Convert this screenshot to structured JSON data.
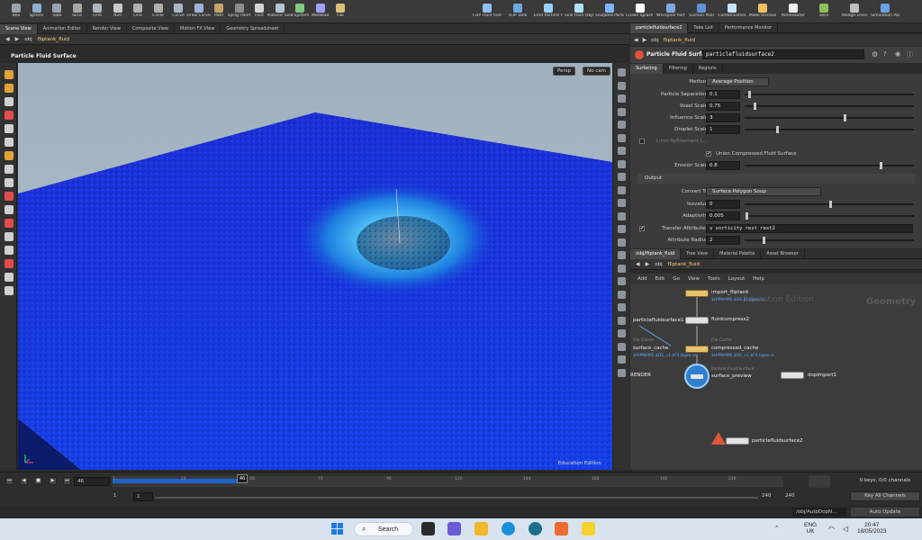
{
  "shelf": {
    "tools": [
      "Box",
      "Sphere",
      "Tube",
      "Torus",
      "Grid",
      "Null",
      "Line",
      "Circle",
      "Curve",
      "Draw Curve",
      "Path",
      "Spray Paint",
      "Font",
      "Platonic Solids",
      "L-System",
      "Metaball",
      "File"
    ],
    "right_tools": [
      "FLIP Fluid from Object",
      "FLIP Tank",
      "Emit Particle Fluid",
      "Sink from Objects",
      "Sculpted Particle Fluid",
      "Crown Splash Particle Fluid",
      "Whirlpool Particle Fluid",
      "Suction Pool",
      "Condensation",
      "Make Viscous",
      "Whitewater",
      "Slice",
      "Wedge Lines",
      "Simulation Particle Fluid"
    ]
  },
  "left_panel": {
    "tabs": [
      "Scene View",
      "Animation Editor",
      "Render View",
      "Composite View",
      "Motion FX View",
      "Geometry Spreadsheet"
    ],
    "path": [
      "obj",
      "fliptank_fluid"
    ],
    "viewport_title": "Particle Fluid Surface",
    "camera_menu": "Persp",
    "cam_menu": "No cam",
    "watermark": "Education Edition"
  },
  "param_panel": {
    "tabs": [
      "particlefluidsurface2",
      "Take List",
      "Performance Monitor"
    ],
    "node_type": "Particle Fluid Surface",
    "node_name": "particlefluidsurface2",
    "sub_tabs": [
      "Surfacing",
      "Filtering",
      "Regions"
    ],
    "params": {
      "method_label": "Method",
      "method_value": "Average Position",
      "psep_label": "Particle Separation",
      "psep_value": "0.1",
      "voxel_label": "Voxel Scale",
      "voxel_value": "0.75",
      "influence_label": "Influence Scale",
      "influence_value": "3",
      "droplet_label": "Droplet Scale",
      "droplet_value": "1",
      "limit_label": "Limit Refinement L...",
      "union_label": "Union Compressed Fluid Surface",
      "erosion_label": "Erosion Scale",
      "erosion_value": "0.8",
      "output_header": "Output",
      "convert_label": "Convert To",
      "convert_value": "Surface Polygon Soup",
      "iso_label": "Isovalue",
      "iso_value": "0",
      "adapt_label": "Adaptivity",
      "adapt_value": "0.005",
      "transfer_label": "Transfer Attributes",
      "transfer_value": "v vorticity rest rest2",
      "attrrad_label": "Attribute Radius",
      "attrrad_value": "2"
    }
  },
  "network_panel": {
    "tabs": [
      "/obj/fliptank_fluid",
      "Tree View",
      "Material Palette",
      "Asset Browser"
    ],
    "path": [
      "obj",
      "fliptank_fluid"
    ],
    "menu": [
      "Add",
      "Edit",
      "Go",
      "View",
      "Tools",
      "Layout",
      "Help"
    ],
    "watermark_edition": "Education Edition",
    "watermark_context": "Geometry",
    "nodes": {
      "import": {
        "name": "import_fliptank",
        "sub": "$HIPNAME.$OS.$F.bgeo.sc"
      },
      "compress": {
        "name": "fluidcompress2"
      },
      "pfs1": {
        "name": "particlefluidsurface1"
      },
      "cache": {
        "cap": "File Cache",
        "name": "compressed_cache",
        "sub": "$HIPNAME.$OS_v1.$F4.bgeo.sc"
      },
      "surfcache": {
        "cap": "File Cache",
        "name": "surface_cache",
        "sub": "$HIPNAME.$OS_v1.$F4.bgeo.sc"
      },
      "preview": {
        "cap": "Particle Fluid Surface",
        "name": "surface_preview"
      },
      "render": {
        "name": "RENDER"
      },
      "dop": {
        "name": "dopimport1"
      },
      "pfs2": {
        "name": "particlefluidsurface2"
      }
    }
  },
  "timeline": {
    "current_frame": "46",
    "start": "1",
    "start2": "1",
    "end": "240",
    "end2": "240",
    "ticks": [
      "1",
      "24",
      "48",
      "72",
      "96",
      "120",
      "144",
      "168",
      "192",
      "216"
    ],
    "keys_label": "0 keys, 0/0 channels",
    "channels_button": "Key All Channels",
    "auto_update": "Auto Update",
    "path_label": "/obj/AutoDopN..."
  },
  "taskbar": {
    "search": "Search",
    "lang": "ENG",
    "region": "UK",
    "time": "20:47",
    "date": "18/05/2023"
  }
}
